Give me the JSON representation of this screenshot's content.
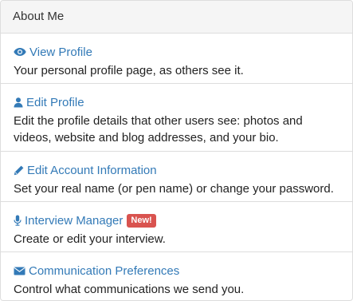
{
  "panel": {
    "heading": "About Me"
  },
  "items": [
    {
      "title": "View Profile",
      "description": "Your personal profile page, as others see it.",
      "icon": "eye-icon"
    },
    {
      "title": "Edit Profile",
      "description": "Edit the profile details that other users see: photos and videos, website and blog addresses, and your bio.",
      "icon": "user-icon"
    },
    {
      "title": "Edit Account Information",
      "description": "Set your real name (or pen name) or change your password.",
      "icon": "pencil-icon"
    },
    {
      "title": "Interview Manager",
      "badge": "New!",
      "description": "Create or edit your interview.",
      "icon": "microphone-icon"
    },
    {
      "title": "Communication Preferences",
      "description": "Control what communications we send you.",
      "icon": "envelope-icon"
    }
  ],
  "colors": {
    "link": "#337ab7",
    "badge": "#d9534f",
    "heading_bg": "#f5f5f5",
    "border": "#dddddd"
  }
}
